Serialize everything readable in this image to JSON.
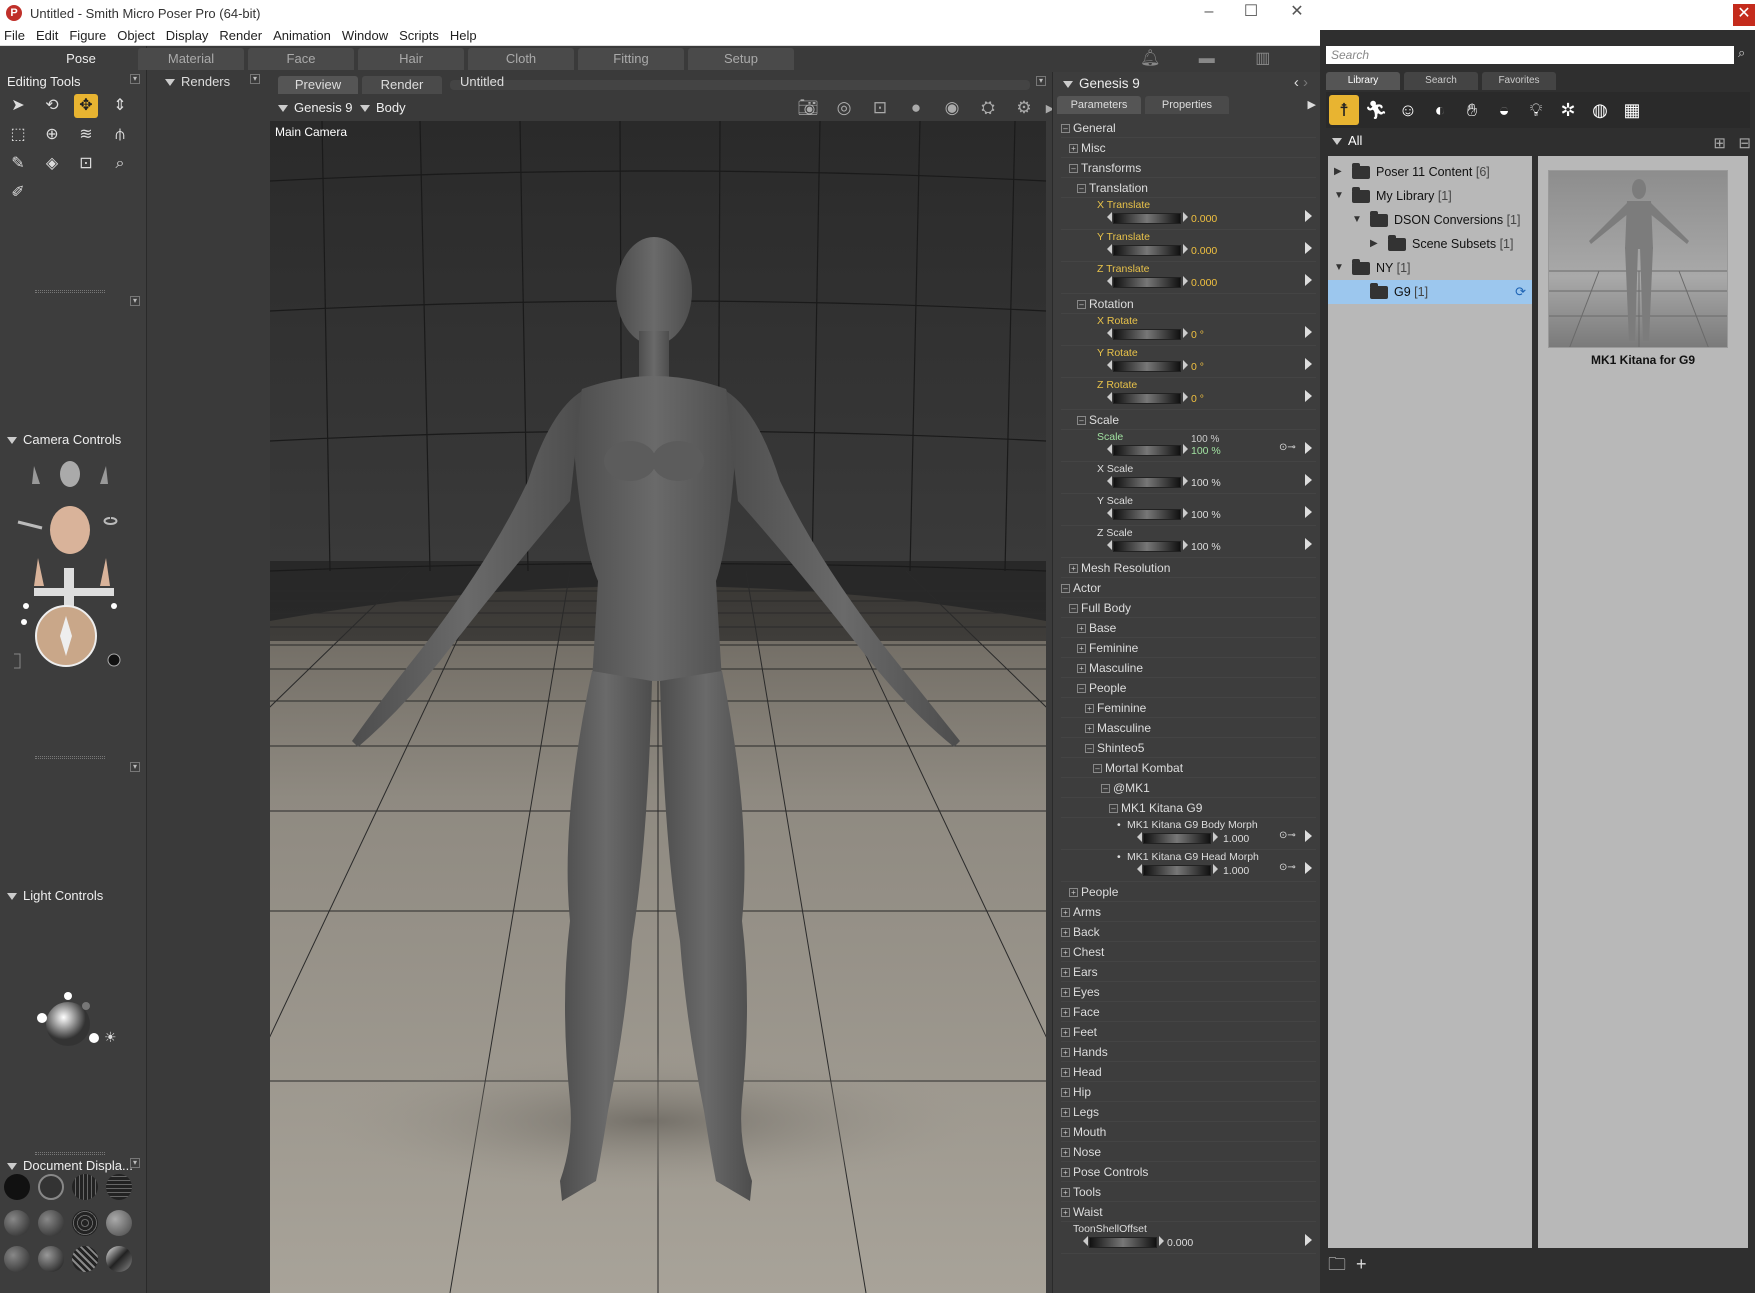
{
  "window": {
    "title": "Untitled - Smith Micro Poser Pro  (64-bit)",
    "menu": [
      "File",
      "Edit",
      "Figure",
      "Object",
      "Display",
      "Render",
      "Animation",
      "Window",
      "Scripts",
      "Help"
    ]
  },
  "rooms": [
    "Pose",
    "Material",
    "Face",
    "Hair",
    "Cloth",
    "Fitting",
    "Setup"
  ],
  "left": {
    "editing_tools": "Editing Tools",
    "camera_controls": "Camera Controls",
    "light_controls": "Light Controls",
    "document_display": "Document Displa..."
  },
  "renders": "Renders",
  "viewport": {
    "tabs": [
      "Preview",
      "Render"
    ],
    "doc_title": "Untitled",
    "figure": "Genesis 9",
    "actor": "Body",
    "camera": "Main Camera"
  },
  "params": {
    "title": "Genesis 9",
    "tabs": [
      "Parameters",
      "Properties"
    ],
    "general": "General",
    "misc": "Misc",
    "transforms": "Transforms",
    "translation": "Translation",
    "x_translate": "X Translate",
    "x_translate_val": "0.000",
    "y_translate": "Y Translate",
    "y_translate_val": "0.000",
    "z_translate": "Z Translate",
    "z_translate_val": "0.000",
    "rotation": "Rotation",
    "x_rotate": "X Rotate",
    "x_rotate_val": "0 °",
    "y_rotate": "Y Rotate",
    "y_rotate_val": "0 °",
    "z_rotate": "Z Rotate",
    "z_rotate_val": "0 °",
    "scale_group": "Scale",
    "scale": "Scale",
    "scale_val_top": "100 %",
    "scale_val": "100 %",
    "x_scale": "X Scale",
    "x_scale_val": "100 %",
    "y_scale": "Y Scale",
    "y_scale_val": "100 %",
    "z_scale": "Z Scale",
    "z_scale_val": "100 %",
    "mesh_resolution": "Mesh Resolution",
    "actor": "Actor",
    "full_body": "Full Body",
    "base": "Base",
    "feminine": "Feminine",
    "masculine": "Masculine",
    "people": "People",
    "people_feminine": "Feminine",
    "people_masculine": "Masculine",
    "shinteo5": "Shinteo5",
    "mortal_kombat": "Mortal Kombat",
    "mk1": "@MK1",
    "mk1_kitana": "MK1 Kitana G9",
    "body_morph": "MK1 Kitana G9 Body Morph",
    "body_morph_val": "1.000",
    "head_morph": "MK1 Kitana G9 Head Morph",
    "head_morph_val": "1.000",
    "groups": [
      "People",
      "Arms",
      "Back",
      "Chest",
      "Ears",
      "Eyes",
      "Face",
      "Feet",
      "Hands",
      "Head",
      "Hip",
      "Legs",
      "Mouth",
      "Nose",
      "Pose Controls",
      "Tools",
      "Waist"
    ],
    "toonshell": "ToonShellOffset",
    "toonshell_val": "0.000"
  },
  "library": {
    "search_placeholder": "Search",
    "tabs": [
      "Library",
      "Search",
      "Favorites"
    ],
    "all": "All",
    "tree": [
      {
        "label": "Poser 11 Content",
        "count": "[6]"
      },
      {
        "label": "My Library",
        "count": "[1]"
      },
      {
        "label": "DSON Conversions",
        "count": "[1]"
      },
      {
        "label": "Scene Subsets",
        "count": "[1]"
      },
      {
        "label": "NY",
        "count": "[1]"
      },
      {
        "label": "G9",
        "count": "[1]"
      }
    ],
    "thumb_label": "MK1 Kitana for G9"
  }
}
